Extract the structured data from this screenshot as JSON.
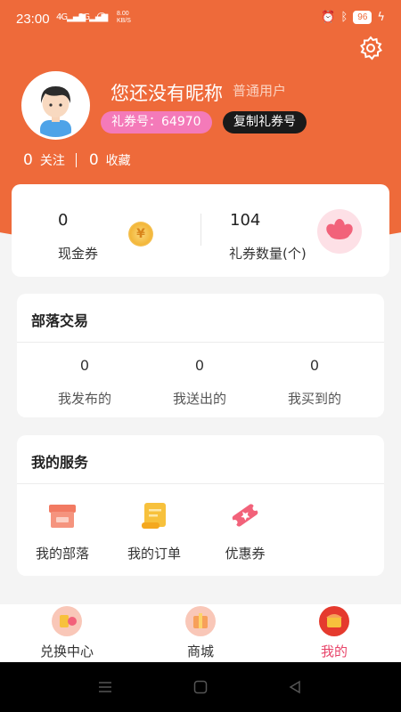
{
  "status_bar": {
    "time": "23:00",
    "signal1": "4G",
    "signal2": "2G",
    "net_speed_value": "8.00",
    "net_speed_unit": "KB/S",
    "battery": "96"
  },
  "profile": {
    "nickname": "您还没有昵称",
    "user_type": "普通用户",
    "coupon_id_label": "礼券号：",
    "coupon_id_value": "64970",
    "copy_button": "复制礼券号",
    "following_count": "0",
    "following_label": "关注",
    "favorites_count": "0",
    "favorites_label": "收藏"
  },
  "wallet": {
    "cash_value": "0",
    "cash_label": "现金券",
    "coin_glyph": "¥",
    "gift_value": "104",
    "gift_label": "礼券数量(个)"
  },
  "tribe": {
    "title": "部落交易",
    "stats": [
      {
        "value": "0",
        "label": "我发布的"
      },
      {
        "value": "0",
        "label": "我送出的"
      },
      {
        "value": "0",
        "label": "我买到的"
      }
    ]
  },
  "services": {
    "title": "我的服务",
    "items": [
      {
        "label": "我的部落",
        "icon": "shop-icon"
      },
      {
        "label": "我的订单",
        "icon": "scroll-icon"
      },
      {
        "label": "优惠券",
        "icon": "ticket-icon"
      }
    ]
  },
  "bottom_nav": {
    "items": [
      {
        "label": "兑换中心",
        "icon": "exchange-icon"
      },
      {
        "label": "商城",
        "icon": "mall-icon"
      },
      {
        "label": "我的",
        "icon": "profile-icon",
        "active": true
      }
    ]
  },
  "colors": {
    "header": "#ee6a3a",
    "pink_badge": "#f47ab9",
    "active_tab": "#e8456a"
  }
}
